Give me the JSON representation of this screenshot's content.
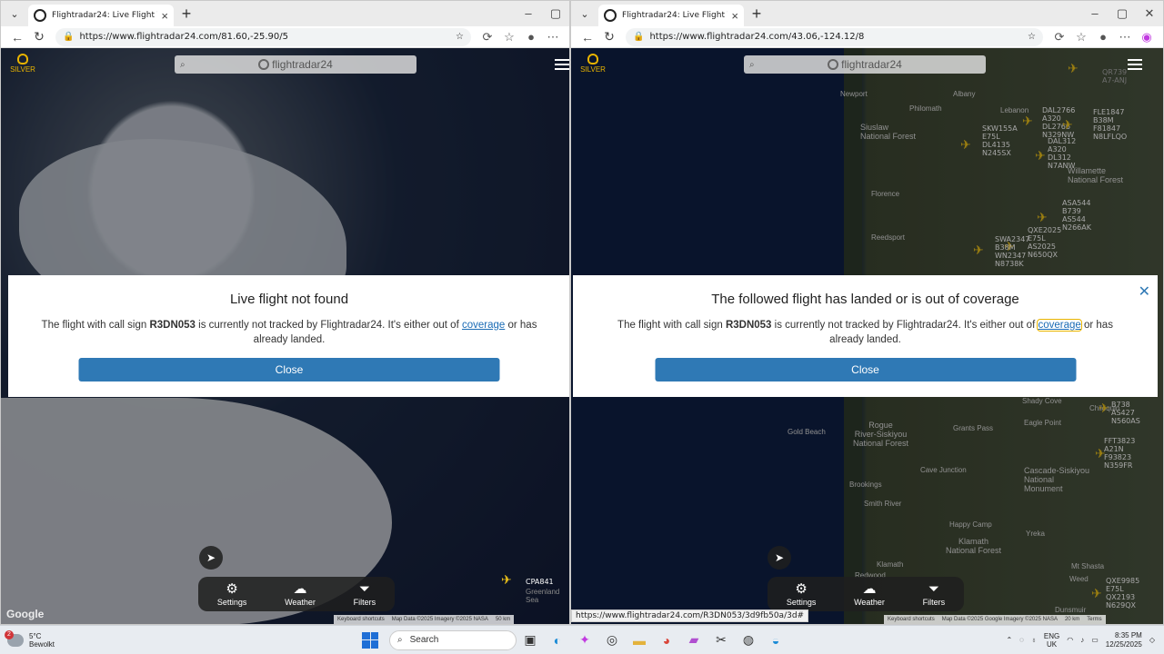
{
  "left": {
    "tab_title": "Flightradar24: Live Flight Tracker -",
    "url": "https://www.flightradar24.com/81.60,-25.90/5",
    "silver": "SILVER",
    "search_logo": "flightradar24",
    "dialog": {
      "title": "Live flight not found",
      "msg_pre": "The flight with call sign ",
      "callsign": "R3DN053",
      "msg_mid": " is currently not tracked by Flightradar24. It's either out of ",
      "link": "coverage",
      "msg_post": " or has already landed.",
      "button": "Close"
    },
    "toolbar": {
      "settings": "Settings",
      "weather": "Weather",
      "filters": "Filters"
    },
    "flight_label": "CPA841",
    "region_label": "Greenland Sea",
    "google": "Google",
    "footer": [
      "Keyboard shortcuts",
      "Map Data ©2025 Imagery ©2025 NASA",
      "50 km"
    ]
  },
  "right": {
    "tab_title": "Flightradar24: Live Flight Tracker -",
    "url": "https://www.flightradar24.com/43.06,-124.12/8",
    "silver": "SILVER",
    "search_logo": "flightradar24",
    "dialog": {
      "title": "The followed flight has landed or is out of coverage",
      "msg_pre": "The flight with call sign ",
      "callsign": "R3DN053",
      "msg_mid": " is currently not tracked by Flightradar24. It's either out of ",
      "link": "coverage",
      "msg_post": " or has already landed.",
      "button": "Close"
    },
    "toolbar": {
      "settings": "Settings",
      "weather": "Weather",
      "filters": "Filters"
    },
    "cities": {
      "newport": "Newport",
      "philomath": "Philomath",
      "albany": "Albany",
      "lebanon": "Lebanon",
      "siuslaw": "Siuslaw\nNational Forest",
      "florence": "Florence",
      "reedsport": "Reedsport",
      "willamette": "Willamette\nNational Forest",
      "goldbeach": "Gold Beach",
      "grantspass": "Grants Pass",
      "rogue": "Rogue\nRiver-Siskiyou\nNational Forest",
      "brookings": "Brookings",
      "smithriver": "Smith River",
      "cavejunction": "Cave Junction",
      "eaglepoint": "Eagle Point",
      "shadycove": "Shady Cove",
      "cascade": "Cascade-Siskiyou\nNational\nMonument",
      "happycamp": "Happy Camp",
      "klamath": "Klamath",
      "klamathnf": "Klamath\nNational Forest",
      "yreka": "Yreka",
      "redwood": "Redwood",
      "mtshasta": "Mt Shasta",
      "chiloquin": "Chiloquin",
      "weed": "Weed",
      "dunsmuir": "Dunsmuir"
    },
    "flights": [
      "DAL2766\nA320\nDL2766\nN329NW",
      "FLE1847\nB38M\nF81847\nN8LFLQO",
      "SKW155A\nE75L\nDL4135\nN245SX",
      "DAL312\nA320\nDL312\nN7ANW",
      "ASA544\nB739\nAS544\nN266AK",
      "QXE2025\nE75L\nAS2025\nN650QX",
      "SWA2347\nB38M\nWN2347\nN8738K",
      "QR739\nA7-ANJ",
      "B738\nAS427\nN560AS",
      "FFT3823\nA21N\nF93823\nN359FR",
      "QXE9985\nE75L\nQX2193\nN629QX"
    ],
    "status_url": "https://www.flightradar24.com/R3DN053/3d9fb50a/3d#",
    "footer": [
      "Keyboard shortcuts",
      "Map Data ©2025 Google Imagery ©2025 NASA",
      "20 km",
      "Terms"
    ]
  },
  "taskbar": {
    "temp": "5°C",
    "condition": "Bewolkt",
    "badge": "2",
    "search": "Search",
    "lang": "ENG",
    "region": "UK",
    "time": "8:35 PM",
    "date": "12/25/2025"
  }
}
